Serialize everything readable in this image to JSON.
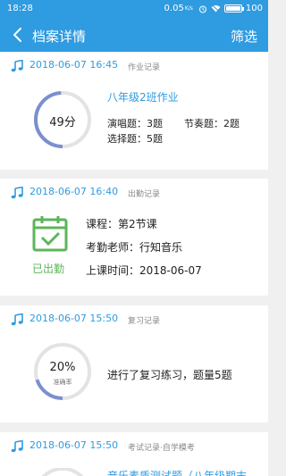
{
  "status_bar": {
    "time": "18:28",
    "network_speed": "0.05",
    "network_unit": "K/s",
    "battery": "100"
  },
  "nav": {
    "title": "档案详情",
    "filter_label": "筛选"
  },
  "cards": [
    {
      "date": "2018-06-07 16:45",
      "type": "作业记录",
      "score": "49分",
      "score_fraction": 0.49,
      "title": "八年级2班作业",
      "line1a": "演唱题：3题",
      "line1b": "节奏题：2题",
      "line2": "选择题：5题"
    },
    {
      "date": "2018-06-07 16:40",
      "type": "出勤记录",
      "status": "已出勤",
      "course": "课程：第2节课",
      "teacher": "考勤老师：行知音乐",
      "time": "上课时间：2018-06-07"
    },
    {
      "date": "2018-06-07 15:50",
      "type": "复习记录",
      "rate": "20%",
      "rate_label": "准确率",
      "rate_fraction": 0.2,
      "summary": "进行了复习练习，题量5题"
    },
    {
      "date": "2018-06-07 15:50",
      "type": "考试记录·自学模考",
      "title": "音乐素质测试题（八年级期末"
    }
  ],
  "colors": {
    "primary": "#2f9be0",
    "ring": "#7b8fd0",
    "present": "#5db55a",
    "track": "#e3e3e3"
  }
}
